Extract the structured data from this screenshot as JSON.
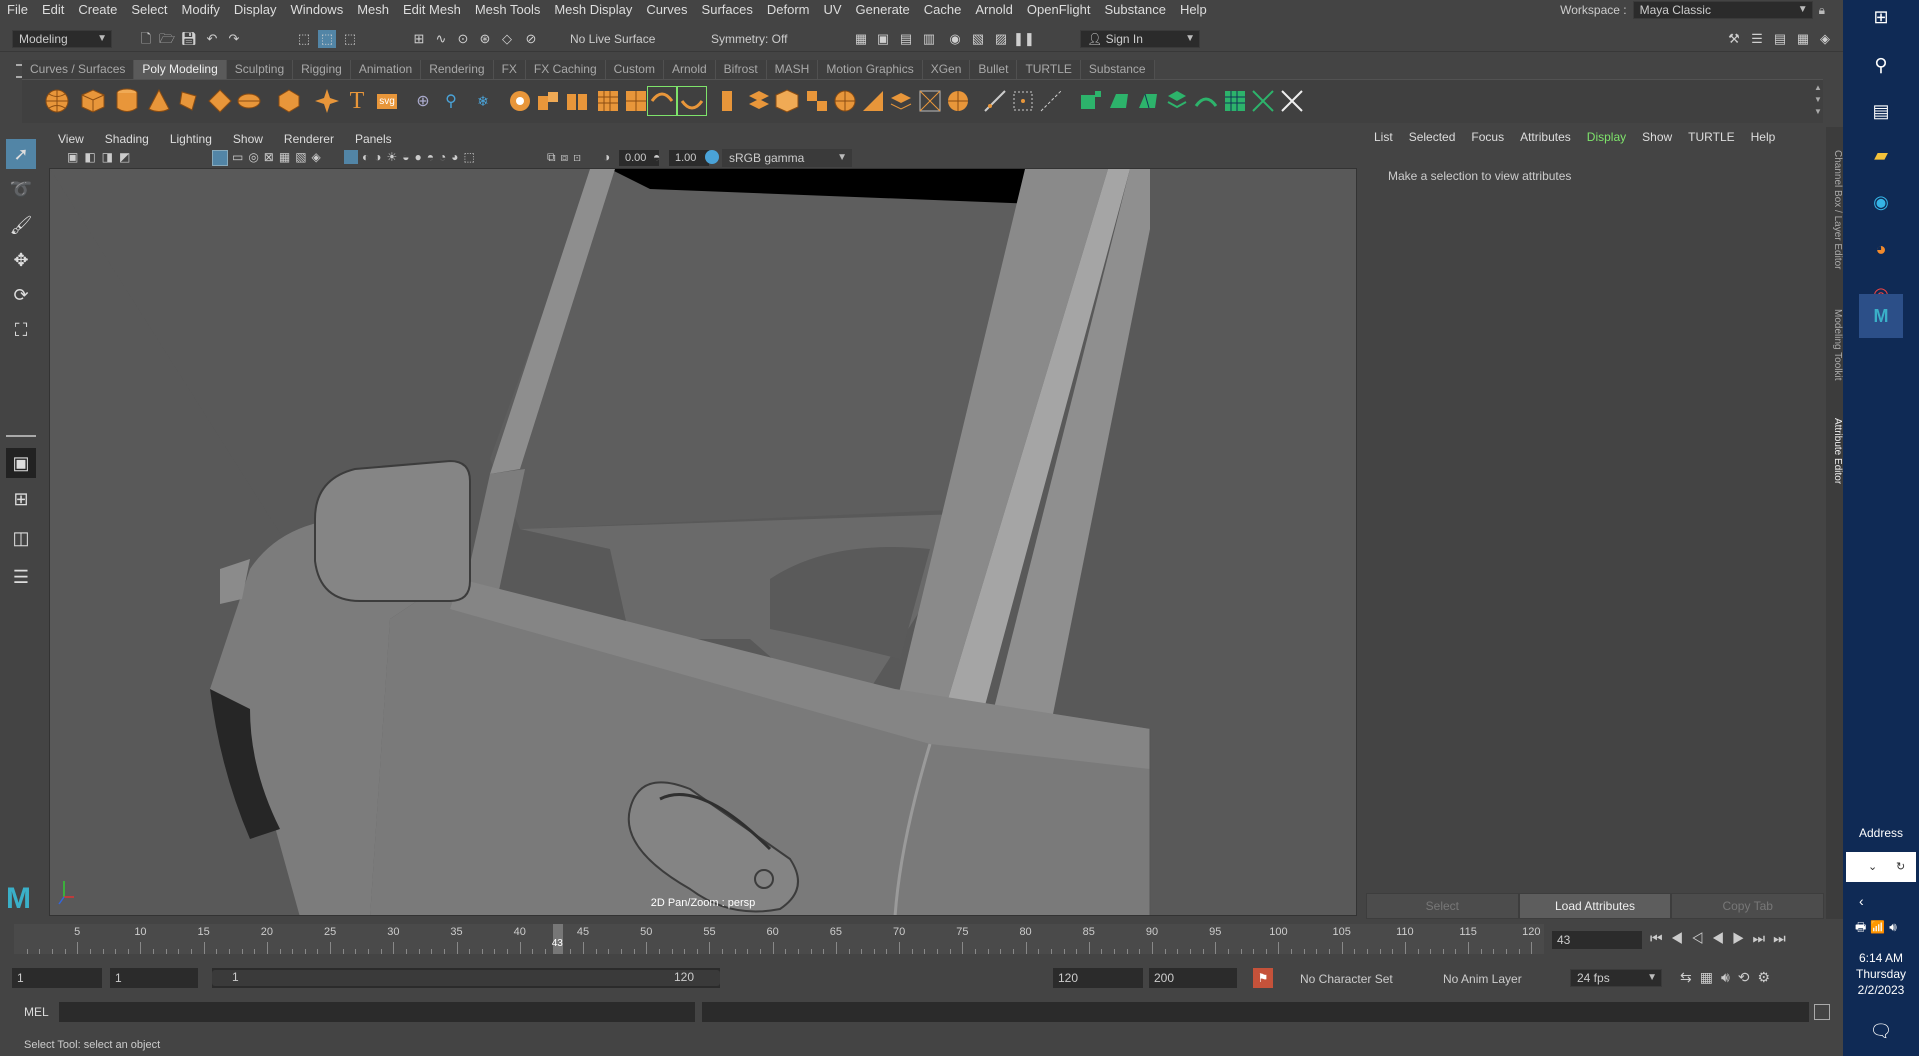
{
  "menubar": [
    "File",
    "Edit",
    "Create",
    "Select",
    "Modify",
    "Display",
    "Windows",
    "Mesh",
    "Edit Mesh",
    "Mesh Tools",
    "Mesh Display",
    "Curves",
    "Surfaces",
    "Deform",
    "UV",
    "Generate",
    "Cache",
    "Arnold",
    "OpenFlight",
    "Substance",
    "Help"
  ],
  "workspace": {
    "label": "Workspace :",
    "value": "Maya Classic"
  },
  "statusline": {
    "mode": "Modeling",
    "live_surface": "No Live Surface",
    "symmetry": "Symmetry: Off",
    "sign_in": "Sign In"
  },
  "shelf_tabs": [
    "Curves / Surfaces",
    "Poly Modeling",
    "Sculpting",
    "Rigging",
    "Animation",
    "Rendering",
    "FX",
    "FX Caching",
    "Custom",
    "Arnold",
    "Bifrost",
    "MASH",
    "Motion Graphics",
    "XGen",
    "Bullet",
    "TURTLE",
    "Substance"
  ],
  "shelf_active": "Poly Modeling",
  "viewport": {
    "menu": [
      "View",
      "Shading",
      "Lighting",
      "Show",
      "Renderer",
      "Panels"
    ],
    "exposure": "0.00",
    "gamma": "1.00",
    "colorspace": "sRGB gamma",
    "label": "2D Pan/Zoom : persp"
  },
  "attribute_editor": {
    "menu": [
      "List",
      "Selected",
      "Focus",
      "Attributes",
      "Display",
      "Show",
      "TURTLE",
      "Help"
    ],
    "active_menu": "Display",
    "hint": "Make a selection to view attributes",
    "buttons": {
      "select": "Select",
      "load": "Load Attributes",
      "copy": "Copy Tab"
    },
    "side_tabs": [
      "Channel Box / Layer Editor",
      "Modeling Toolkit",
      "Attribute Editor"
    ]
  },
  "timeline": {
    "ticks": [
      "5",
      "10",
      "15",
      "20",
      "25",
      "30",
      "35",
      "40",
      "45",
      "50",
      "55",
      "60",
      "65",
      "70",
      "75",
      "80",
      "85",
      "90",
      "95",
      "100",
      "105",
      "110",
      "115",
      "120"
    ],
    "current_frame": "43",
    "current_field": "43"
  },
  "range": {
    "start": "1",
    "anim_start": "1",
    "slider_start": "1",
    "slider_end": "120",
    "end": "120",
    "anim_end": "200",
    "character_set": "No Character Set",
    "anim_layer": "No Anim Layer",
    "fps": "24 fps"
  },
  "command": {
    "lang": "MEL"
  },
  "help_line": "Select Tool: select an object",
  "taskbar": {
    "address_label": "Address",
    "time": "6:14 AM",
    "day": "Thursday",
    "date": "2/2/2023"
  },
  "colors": {
    "accent": "#5285a6",
    "active_green": "#7ee36b",
    "viewport_bg": "#595959",
    "taskbar": "#0f2a55"
  }
}
